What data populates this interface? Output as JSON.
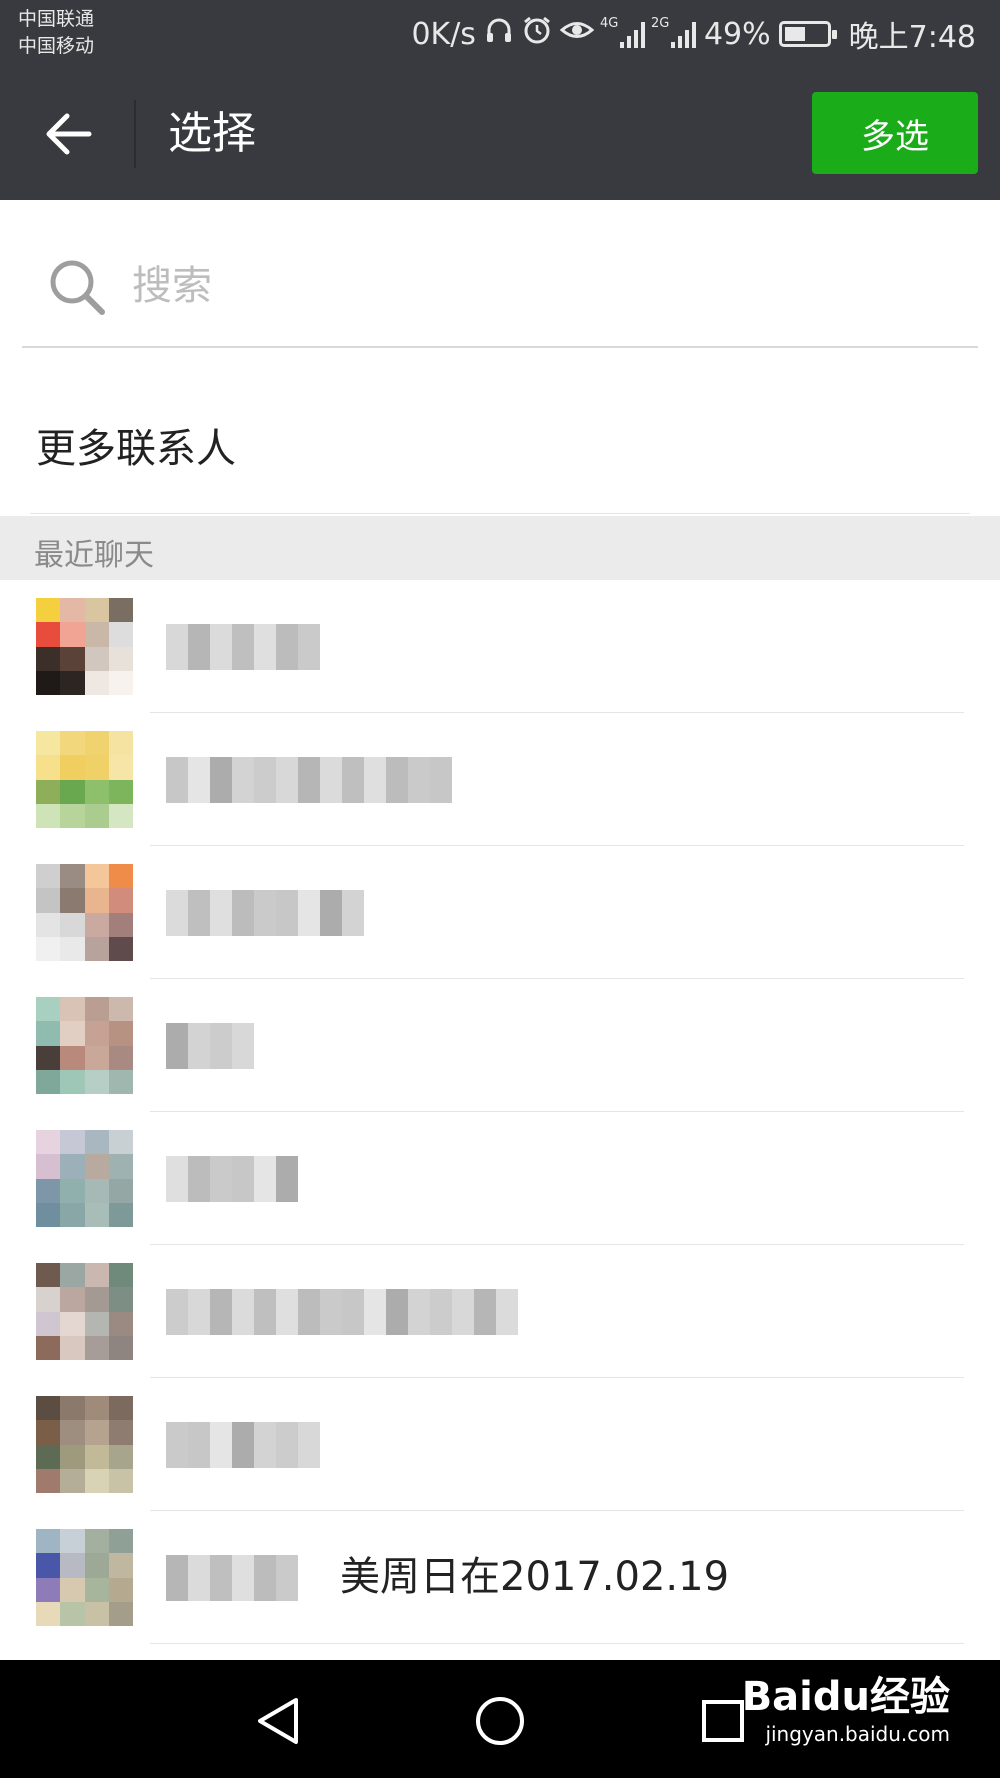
{
  "status_bar": {
    "carrier_1": "中国联通",
    "carrier_2": "中国移动",
    "speed": "0K/s",
    "network_1": "4G",
    "network_2": "2G",
    "battery": "49%",
    "battery_level": 0.49,
    "time": "晚上7:48"
  },
  "header": {
    "title": "选择",
    "multi_select_label": "多选",
    "accent": "#1aad19",
    "background": "#393a3f"
  },
  "search": {
    "placeholder": "搜索",
    "value": ""
  },
  "more_contacts": {
    "label": "更多联系人"
  },
  "section": {
    "label": "最近聊天"
  },
  "chats": [
    {
      "name": ""
    },
    {
      "name": ""
    },
    {
      "name": ""
    },
    {
      "name": ""
    },
    {
      "name": ""
    },
    {
      "name": ""
    },
    {
      "name": ""
    },
    {
      "name": "美周日在2017.02.19"
    }
  ],
  "nav": {
    "back": "back-triangle-icon",
    "home": "home-circle-icon",
    "recents": "recents-square-icon"
  },
  "watermark": {
    "main": "Baidu经验",
    "sub": "jingyan.baidu.com"
  }
}
